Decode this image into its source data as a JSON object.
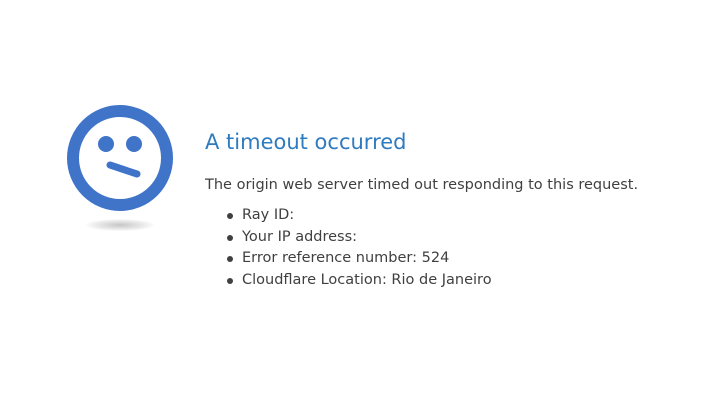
{
  "error": {
    "title": "A timeout occurred",
    "message": "The origin web server timed out responding to this request.",
    "details": [
      "Ray ID:",
      "Your IP address:",
      "Error reference number: 524",
      "Cloudflare Location: Rio de Janeiro"
    ]
  },
  "icon": {
    "name": "confused-face-icon",
    "color": "#3f74c8"
  },
  "colors": {
    "title": "#2f7bbf",
    "text": "#404040",
    "background": "#ffffff"
  }
}
